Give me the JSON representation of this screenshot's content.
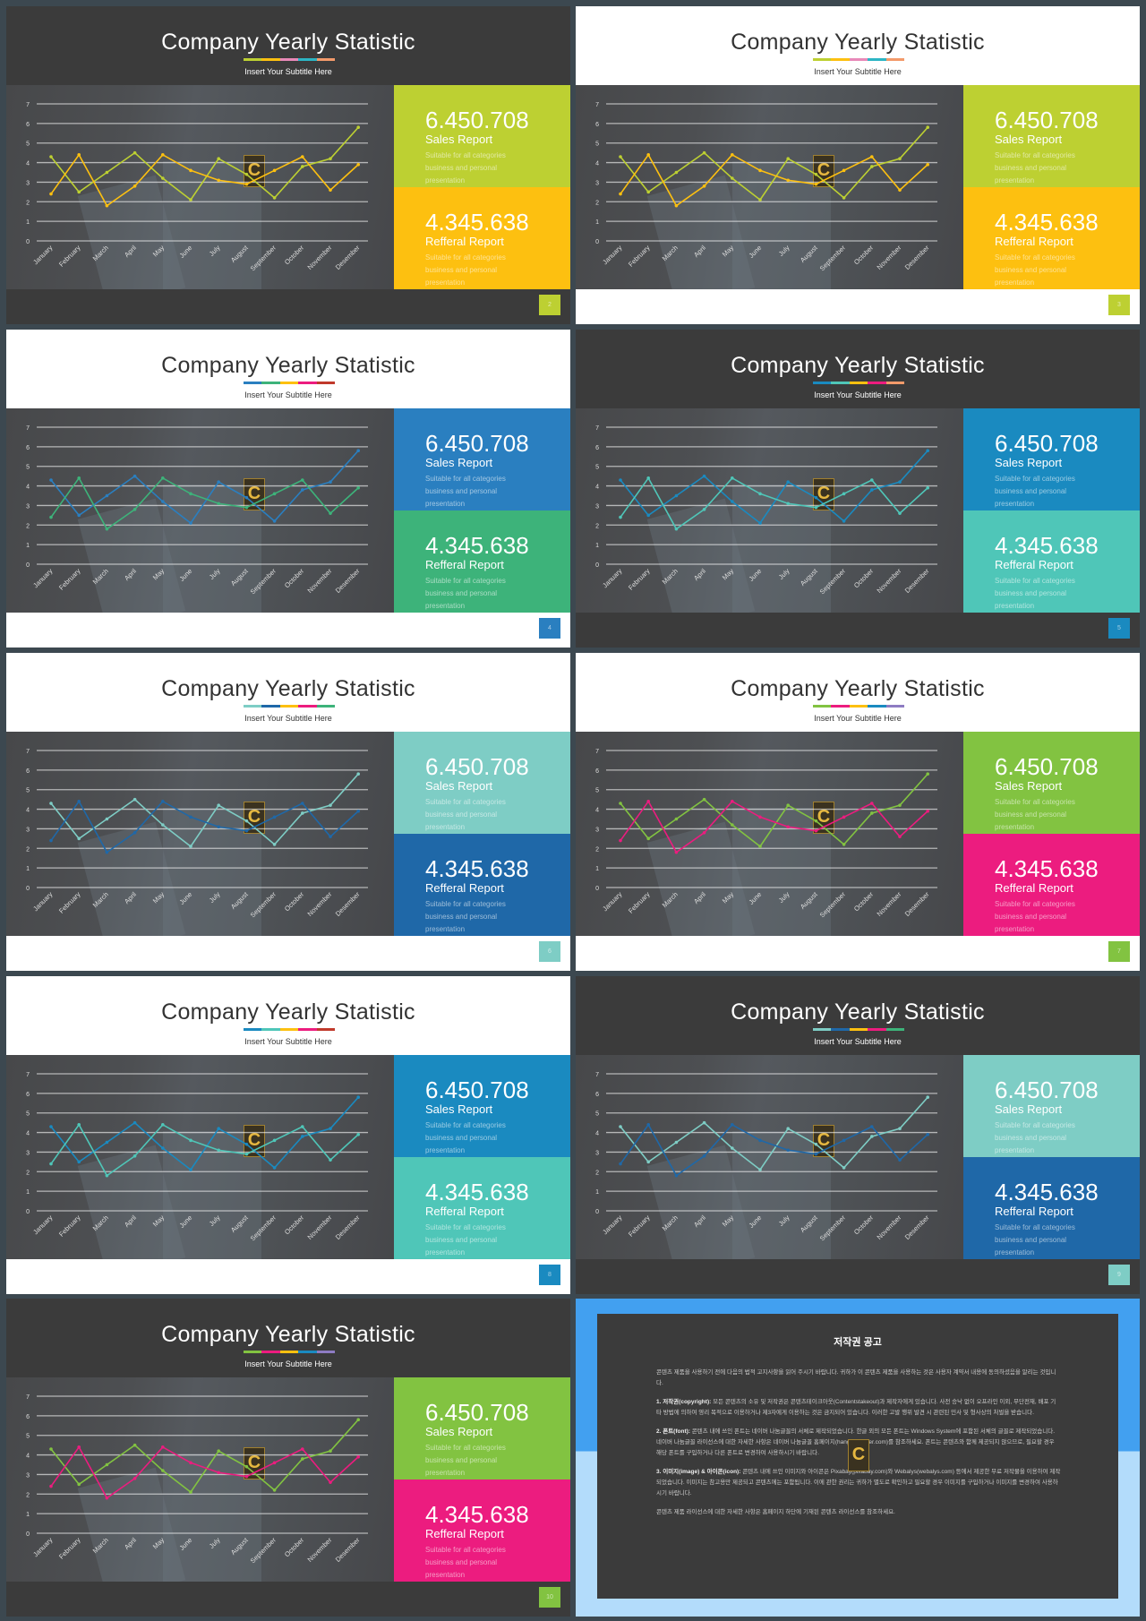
{
  "common": {
    "title": "Company Yearly Statistic",
    "subtitle": "Insert  Your  Subtitle  Here",
    "sales_value": "6.450.708",
    "sales_label": "Sales Report",
    "referral_value": "4.345.638",
    "referral_label": "Refferal Report",
    "panel_desc": "Suitable  for all categories business and personal presentation",
    "logo_letter": "C"
  },
  "chart_data": {
    "type": "line",
    "categories": [
      "January",
      "February",
      "March",
      "April",
      "May",
      "June",
      "July",
      "August",
      "September",
      "October",
      "November",
      "Desember"
    ],
    "y_ticks": [
      0,
      1,
      2,
      3,
      4,
      5,
      6,
      7
    ],
    "ylim": [
      0,
      7
    ],
    "grid": true,
    "series": [
      {
        "values": [
          4.3,
          2.5,
          3.5,
          4.5,
          3.2,
          2.1,
          4.2,
          3.4,
          2.2,
          3.8,
          4.2,
          5.8
        ]
      },
      {
        "values": [
          2.4,
          4.4,
          1.8,
          2.8,
          4.4,
          3.6,
          3.1,
          2.9,
          3.6,
          4.3,
          2.6,
          3.9
        ]
      }
    ]
  },
  "slides": [
    {
      "page": "2",
      "header": "dark",
      "footer": "dark",
      "c1": "#bdd032",
      "c2": "#fdc010",
      "uline": [
        "#bdd032",
        "#fdc010",
        "#e889b8",
        "#2cb5c4",
        "#f39a6a"
      ]
    },
    {
      "page": "3",
      "header": "light",
      "footer": "light",
      "c1": "#bdd032",
      "c2": "#fdc010",
      "uline": [
        "#bdd032",
        "#fdc010",
        "#e889b8",
        "#2cb5c4",
        "#f39a6a"
      ]
    },
    {
      "page": "4",
      "header": "light",
      "footer": "light",
      "c1": "#2a7fc0",
      "c2": "#3db37a",
      "uline": [
        "#2a7fc0",
        "#3db37a",
        "#fdc010",
        "#ec1c7f",
        "#c0392b"
      ]
    },
    {
      "page": "5",
      "header": "dark",
      "footer": "dark",
      "c1": "#1a8ac0",
      "c2": "#4fc6b8",
      "uline": [
        "#1a8ac0",
        "#4fc6b8",
        "#fdc010",
        "#ec1c7f",
        "#f39a6a"
      ]
    },
    {
      "page": "6",
      "header": "light",
      "footer": "light",
      "c1": "#7ecdc5",
      "c2": "#1f68a8",
      "uline": [
        "#7ecdc5",
        "#1f68a8",
        "#fdc010",
        "#ec1c7f",
        "#3db37a"
      ]
    },
    {
      "page": "7",
      "header": "light",
      "footer": "light",
      "c1": "#82c341",
      "c2": "#ec1c7f",
      "uline": [
        "#82c341",
        "#ec1c7f",
        "#fdc010",
        "#1a8ac0",
        "#8e7cc3"
      ]
    },
    {
      "page": "8",
      "header": "light",
      "footer": "light",
      "c1": "#1a8ac0",
      "c2": "#4fc6b8",
      "uline": [
        "#1a8ac0",
        "#4fc6b8",
        "#fdc010",
        "#ec1c7f",
        "#c0392b"
      ]
    },
    {
      "page": "9",
      "header": "dark",
      "footer": "dark",
      "c1": "#7ecdc5",
      "c2": "#1f68a8",
      "uline": [
        "#7ecdc5",
        "#1f68a8",
        "#fdc010",
        "#ec1c7f",
        "#3db37a"
      ]
    },
    {
      "page": "10",
      "header": "dark",
      "footer": "dark",
      "c1": "#82c341",
      "c2": "#ec1c7f",
      "uline": [
        "#82c341",
        "#ec1c7f",
        "#fdc010",
        "#1a8ac0",
        "#8e7cc3"
      ]
    }
  ],
  "copyright": {
    "title": "저작권 공고",
    "intro": "콘텐츠 제품을 사용하기 전에 다음의 법적 고지사항을 읽어 주시기 바랍니다. 귀하가 이 콘텐츠 제품을 사용하는 것은 사용자 계약서 내용에 동의하셨음을 알리는 것입니다.",
    "p1_head": "1. 저작권(copyright):",
    "p1": " 모든 콘텐츠의 소유 및 저작권은 콘텐츠테이크아웃(Contentstakeout)과 제작자에게 있습니다. 사전 승낙 없이 오프라인 이외, 무단전재, 배포 기타 방법에 의하여 영리 목적으로 이용하거나 제3자에게 이용하는 것은 금지되어 있습니다. 이러한 고발 행위 발견 시 관련된 민사 및 형사상의 처벌을 받습니다.",
    "p2_head": "2. 폰트(font):",
    "p2": " 콘텐츠 내에 쓰인 폰트는 네이버 나눔글꼴의 서체로 제작되었습니다. 한글 외의 모든 폰트는 Windows System에 포함된 서체의 글꼴로 제작되었습니다. 네이버 나눔글꼴 라이선스에 대한 자세한 사항은 네이버 나눔글꼴 홈페이지(hangeul.naver.com)를 참조하세요. 폰트는 콘텐츠와 함께 제공되지 않으므로, 필요할 경우 해당 폰트를 구입하거나 다른 폰트로 변경하여 사용하시기 바랍니다.",
    "p3_head": "3. 이미지(image) & 아이콘(icon):",
    "p3": " 콘텐츠 내에 쓰인 이미지와 아이콘은 Pixabay(pixabay.com)와 Webalys(webalys.com) 등에서 제공한 무료 저작물을 이용하여 제작되었습니다. 이미지는 참고용만 제공되고 콘텐츠에는 포함됩니다. 이에 관한 권리는 귀하가 별도로 확인하고 필요할 경우 이미지를 구입하거나 이미지를 변경하여 사용하시기 바랍니다.",
    "outro": "콘텐츠 제품 라이선스에 대한 자세한 사항은 홈페이지 하단에 기재된 콘텐츠 라이선스를 참조하세요.",
    "logo_letter": "C"
  }
}
